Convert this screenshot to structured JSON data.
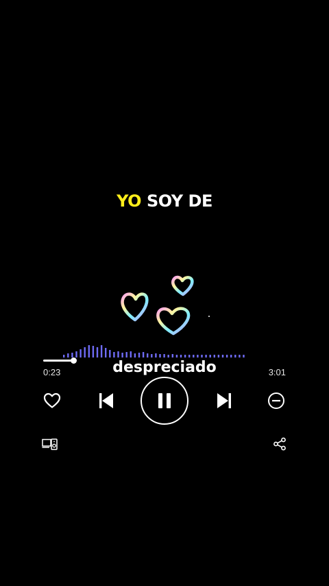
{
  "lyrics": {
    "line_highlight": "YO",
    "line_rest": " SOY DE",
    "current_word": "despreciado"
  },
  "player": {
    "elapsed": "0:23",
    "total": "3:01",
    "progress_fraction": 0.127,
    "state": "playing"
  },
  "icons": {
    "like": "heart-outline-icon",
    "previous": "skip-previous-icon",
    "play_pause": "pause-icon",
    "next": "skip-next-icon",
    "remove": "minus-circle-icon",
    "devices": "connect-device-icon",
    "share": "share-icon"
  },
  "colors": {
    "background": "#000000",
    "highlight": "#ffee1a",
    "text": "#ffffff",
    "visualizer": "#6f6cf6"
  }
}
